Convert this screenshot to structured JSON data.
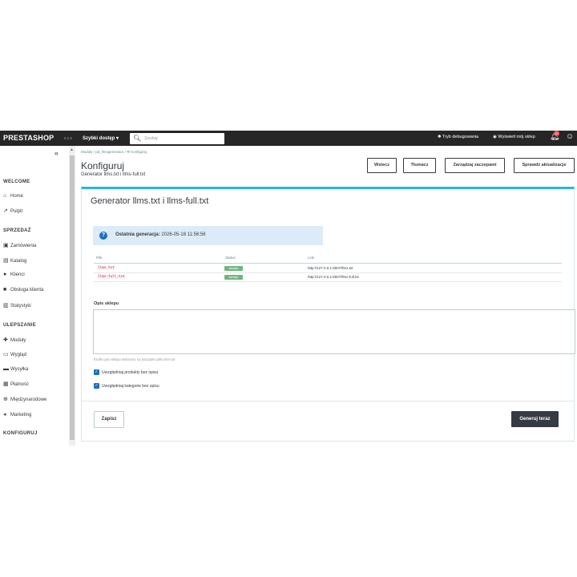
{
  "topbar": {
    "logo": "PRESTASHOP",
    "version": "8.2.6",
    "quick_access": "Szybki dostęp ▾",
    "search_placeholder": "Szukaj",
    "debug_mode": "Tryb debugowania",
    "view_shop": "Wyświetl mój sklep",
    "notifications_count": "10"
  },
  "sidebar": {
    "sections": [
      {
        "title": "WELCOME",
        "items": [
          {
            "label": "Home",
            "icon": "home-icon"
          },
          {
            "label": "Pulpit",
            "icon": "trending-icon"
          }
        ]
      },
      {
        "title": "SPRZEDAŻ",
        "items": [
          {
            "label": "Zamówienia",
            "icon": "cart-icon"
          },
          {
            "label": "Katalog",
            "icon": "store-icon"
          },
          {
            "label": "Klienci",
            "icon": "account-icon"
          },
          {
            "label": "Obsługa klienta",
            "icon": "chat-icon"
          },
          {
            "label": "Statystyki",
            "icon": "chart-icon"
          }
        ]
      },
      {
        "title": "ULEPSZANIE",
        "items": [
          {
            "label": "Moduły",
            "icon": "puzzle-icon"
          },
          {
            "label": "Wygląd",
            "icon": "desktop-icon"
          },
          {
            "label": "Wysyłka",
            "icon": "truck-icon"
          },
          {
            "label": "Płatność",
            "icon": "payment-icon"
          },
          {
            "label": "Międzynarodowe",
            "icon": "globe-icon"
          },
          {
            "label": "Marketing",
            "icon": "campaign-icon"
          }
        ]
      },
      {
        "title": "KONFIGURUJ",
        "items": []
      }
    ]
  },
  "header": {
    "breadcrumb": [
      "Moduły",
      "pd_llmsgenerator",
      "Konfiguruj"
    ],
    "title": "Konfiguruj",
    "subtitle": "Generator llms.txt i llms-full.txt",
    "buttons": [
      "Wstecz",
      "Tłumacz",
      "Zarządzaj zaczepami",
      "Sprawdź aktualizacje"
    ]
  },
  "card": {
    "title": "Generator llms.txt i llms-full.txt",
    "alert_label": "Ostatnia generacja:",
    "alert_value": "2026-05-18 11:56:56",
    "table": {
      "headers": [
        "Plik",
        "Status",
        "Link"
      ],
      "rows": [
        {
          "file": "llms.txt",
          "status": "Istnieje",
          "link": "http://127.0.0.1:9007/llms.txt"
        },
        {
          "file": "llms-full.txt",
          "status": "Istnieje",
          "link": "http://127.0.0.1:9007/llms-full.txt"
        }
      ]
    },
    "desc_label": "Opis sklepu",
    "desc_value": "",
    "help_text": "Krótki opis sklepu widoczny na początku pliku llms.txt",
    "checkboxes": [
      {
        "label": "Uwzględniaj produkty bez opisu",
        "checked": true
      },
      {
        "label": "Uwzględniaj kategorie bez opisu",
        "checked": true
      }
    ],
    "save_label": "Zapisz",
    "generate_label": "Generuj teraz"
  },
  "colors": {
    "topbar": "#262626",
    "accent": "#25b9d7",
    "status_ok": "#70b580",
    "primary_dark": "#363a41"
  }
}
